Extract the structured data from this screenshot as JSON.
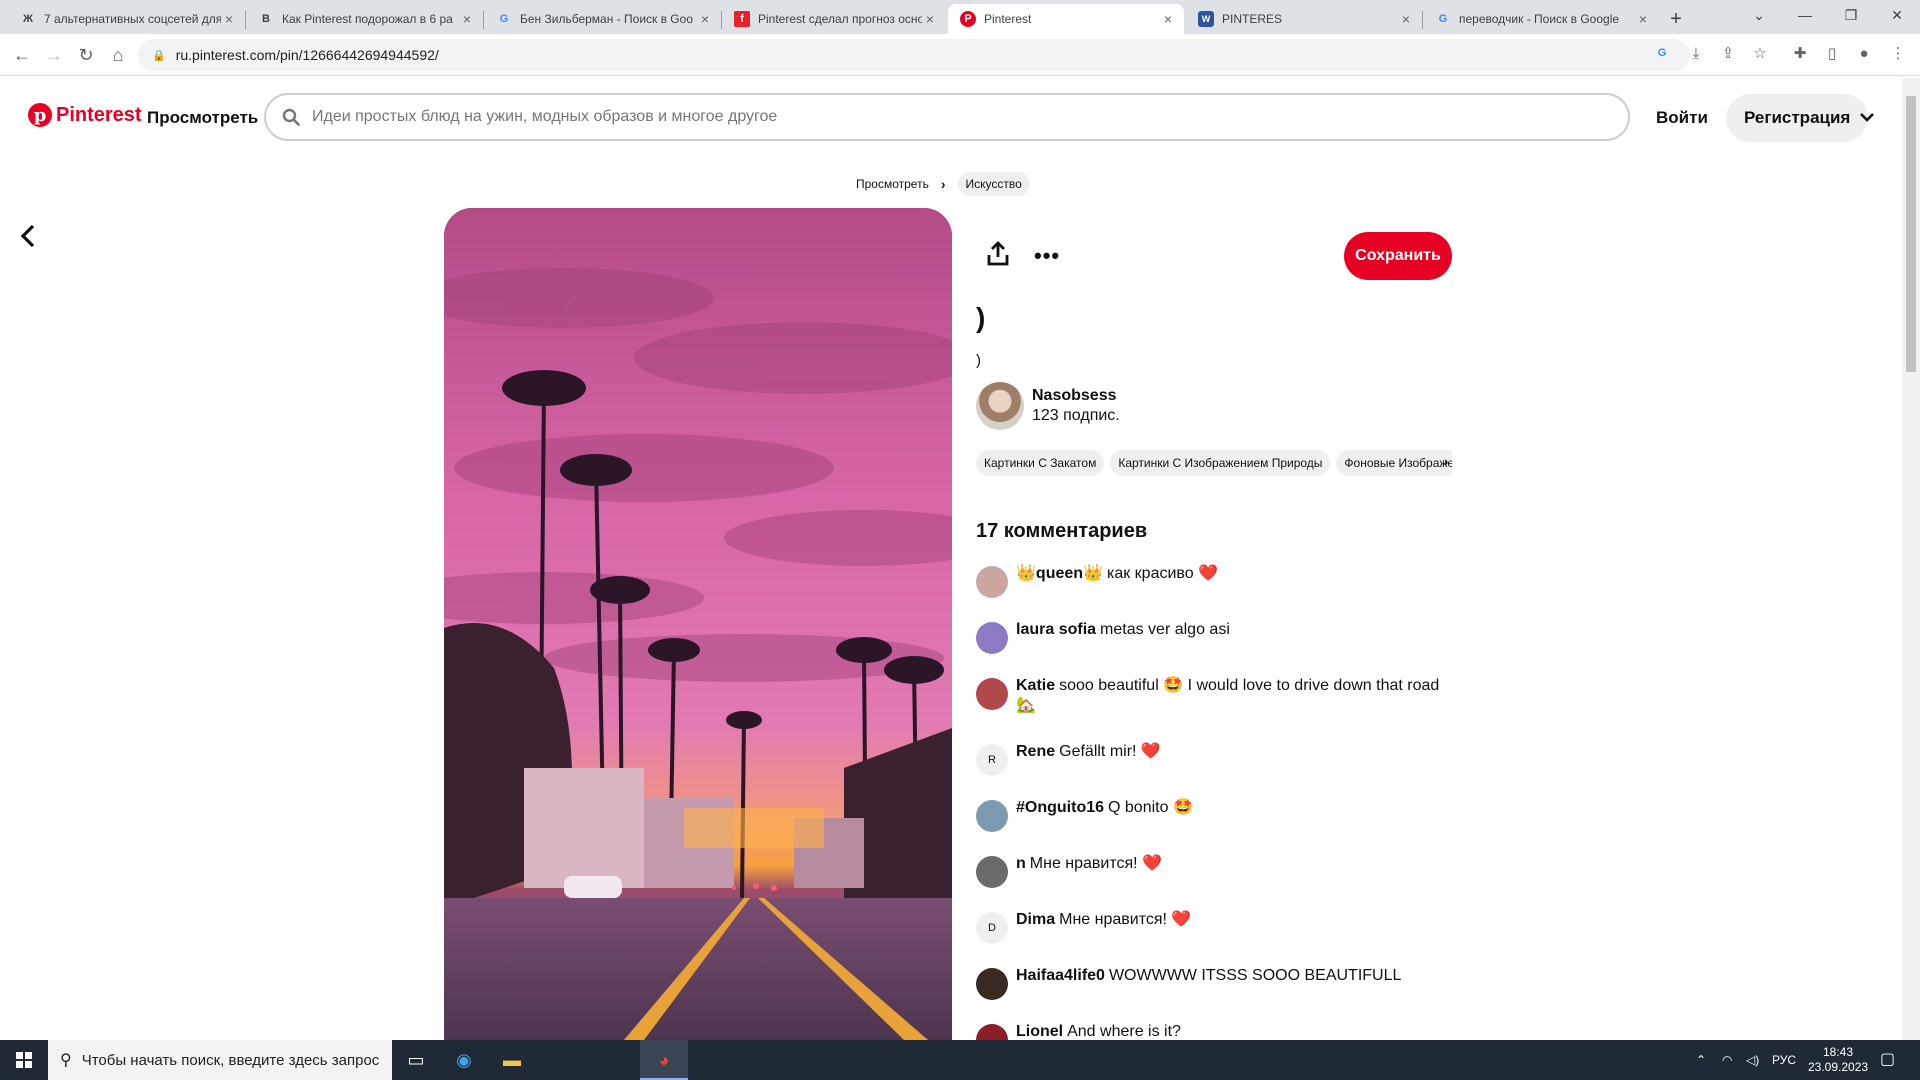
{
  "browser": {
    "tabs": [
      {
        "title": "7 альтернативных соцсетей для",
        "icon": "Ж",
        "active": false
      },
      {
        "title": "Как Pinterest подорожал в 6 ра",
        "icon": "B",
        "active": false
      },
      {
        "title": "Бен Зильберман - Поиск в Goo",
        "icon": "G",
        "active": false
      },
      {
        "title": "Pinterest сделал прогноз основ",
        "icon": "f",
        "active": false
      },
      {
        "title": "Pinterest",
        "icon": "P",
        "active": true
      },
      {
        "title": "PINTERES",
        "icon": "W",
        "active": false
      },
      {
        "title": "переводчик - Поиск в Google",
        "icon": "G",
        "active": false
      }
    ],
    "url": "ru.pinterest.com/pin/12666442694944592/"
  },
  "header": {
    "logo": "Pinterest",
    "explore": "Просмотреть",
    "search_placeholder": "Идеи простых блюд на ужин, модных образов и многое другое",
    "login": "Войти",
    "signup": "Регистрация"
  },
  "breadcrumb": {
    "root": "Просмотреть",
    "current": "Искусство"
  },
  "pin": {
    "save": "Сохранить",
    "title": ")",
    "description": ")",
    "author_name": "Nasobsess",
    "author_followers": "123 подпис.",
    "tags": [
      "Картинки С Закатом",
      "Картинки С Изображением Природы",
      "Фоновые Изображения"
    ]
  },
  "comments": {
    "count_label": "17 комментариев",
    "items": [
      {
        "name": "👑queen👑",
        "text": "как красиво ❤️",
        "avatar": "",
        "avatar_color": "#c9a7a0"
      },
      {
        "name": "laura sofia",
        "text": "metas ver algo asi",
        "avatar": "",
        "avatar_color": "#8e7ac2"
      },
      {
        "name": "Katie",
        "text": "sooo beautiful 🤩 I would love to drive down that road 🏡",
        "avatar": "",
        "avatar_color": "#b04a4a"
      },
      {
        "name": "Rene",
        "text": "Gefällt mir! ❤️",
        "avatar": "R",
        "avatar_color": "#efefef"
      },
      {
        "name": "#Onguito16",
        "text": "Q bonito 🤩",
        "avatar": "",
        "avatar_color": "#7d9bb0"
      },
      {
        "name": "n",
        "text": "Мне нравится! ❤️",
        "avatar": "",
        "avatar_color": "#6b6b6b"
      },
      {
        "name": "Dima",
        "text": "Мне нравится! ❤️",
        "avatar": "D",
        "avatar_color": "#efefef"
      },
      {
        "name": "Haifaa4life0",
        "text": "WOWWWW ITSSS SOOO BEAUTIFULL",
        "avatar": "",
        "avatar_color": "#3a2a24"
      },
      {
        "name": "Lionel",
        "text": "And where is it?",
        "avatar": "",
        "avatar_color": "#8a1f2a"
      }
    ]
  },
  "taskbar": {
    "search_placeholder": "Чтобы начать поиск, введите здесь запрос",
    "lang": "РУС",
    "time": "18:43",
    "date": "23.09.2023"
  },
  "colors": {
    "brand": "#e60023",
    "sky_top": "#c0508a",
    "sky_mid": "#e06aa8",
    "horizon": "#f6a040"
  }
}
